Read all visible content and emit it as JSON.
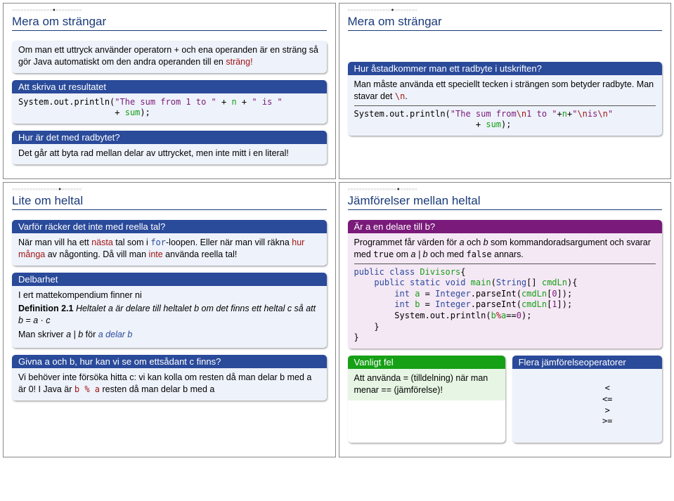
{
  "slides": {
    "tl": {
      "title": "Mera om strängar",
      "b1": {
        "text_a": "Om man ett uttryck använder operatorn + och ena operanden är en sträng så gör Java automatiskt om den andra operanden till en",
        "text_b": "sträng!"
      },
      "b2": {
        "head": "Att skriva ut resultatet",
        "code1": "System.out.println(",
        "code2": "\"The sum from 1 to \"",
        "code3": " + ",
        "code4": "n",
        "code5": " + ",
        "code6": "\" is \"",
        "code7": "                   + ",
        "code8": "sum",
        "code9": ");"
      },
      "b3": {
        "head": "Hur är det med radbytet?",
        "text": "Det går att byta rad mellan delar av uttrycket, men inte mitt i en literal!"
      }
    },
    "tr": {
      "title": "Mera om strängar",
      "b1": {
        "head": "Hur åstadkommer man ett radbyte i utskriften?",
        "text_a": "Man måste använda ett speciellt tecken i strängen som betyder radbyte. Man stavar det ",
        "text_b": "\\n",
        "text_c": ".",
        "code1": "System.out.println(",
        "code2": "\"The sum from",
        "code3": "\\n",
        "code4": "1 to \"",
        "code5": "+",
        "code6": "n",
        "code7": "+",
        "code8": "\"",
        "code9": "\\n",
        "code10": "is",
        "code11": "\\n",
        "code12": "\"",
        "code13": "                        + ",
        "code14": "sum",
        "code15": ");"
      }
    },
    "bl": {
      "title": "Lite om heltal",
      "b1": {
        "head": "Varför räcker det inte med reella tal?",
        "text_a": "När man vill ha ett ",
        "text_b": "nästa",
        "text_c": " tal som i ",
        "text_d": "for",
        "text_e": "-loopen. Eller när man vill räkna ",
        "text_f": "hur många",
        "text_g": " av någonting. Då vill man ",
        "text_h": "inte",
        "text_i": " använda reella tal!"
      },
      "b2": {
        "head": "Delbarhet",
        "l1": "I ert mattekompendium finner ni",
        "l2a": "Definition 2.1",
        "l2b": " Heltalet a är delare till heltalet b om det finns ett heltal c så att b = a · c",
        "l3a": "Man skriver ",
        "l3b": "a | b",
        "l3c": " för ",
        "l3d": "a delar b"
      },
      "b3": {
        "head": "Givna a och b, hur kan vi se om ettsådant c finns?",
        "text_a": "Vi behöver inte försöka hitta c: vi kan kolla om resten då man delar b med a är 0! I Java är ",
        "text_b": "b % a",
        "text_c": " resten då man delar b med a"
      }
    },
    "br": {
      "title": "Jämförelser mellan heltal",
      "b1": {
        "head": "Är a en delare till b?",
        "text_a": "Programmet får värden för ",
        "text_b": "a",
        "text_c": " och ",
        "text_d": "b",
        "text_e": " som kommandoradsargument och svarar med ",
        "text_f": "true",
        "text_g": " om ",
        "text_h": "a | b",
        "text_i": " och med ",
        "text_j": "false",
        "text_k": " annars.",
        "c1": "public class ",
        "c2": "Divisors",
        "c3": "{",
        "c4": "    public static void ",
        "c5": "main",
        "c6": "(",
        "c7": "String",
        "c8": "[] ",
        "c9": "cmdLn",
        "c10": "){",
        "c11": "        int ",
        "c12": "a",
        "c13": " = ",
        "c14": "Integer",
        "c15": ".parseInt(",
        "c16": "cmdLn",
        "c17": "[",
        "c18": "0",
        "c19": "]);",
        "c20": "        int ",
        "c21": "b",
        "c22": " = ",
        "c23": "Integer",
        "c24": ".parseInt(",
        "c25": "cmdLn",
        "c26": "[",
        "c27": "1",
        "c28": "]);",
        "c29": "        System.out.println(",
        "c30": "b",
        "c31": "%",
        "c32": "a",
        "c33": "==",
        "c34": "0",
        "c35": ");",
        "c36": "    }",
        "c37": "}"
      },
      "b2": {
        "head": "Vanligt fel",
        "text_a": "Att använda = (tilldelning) när man menar == (jämförelse)!"
      },
      "b3": {
        "head": "Flera jämförelseoperatorer",
        "op1": "<",
        "op2": "<=",
        "op3": ">",
        "op4": ">="
      }
    }
  }
}
